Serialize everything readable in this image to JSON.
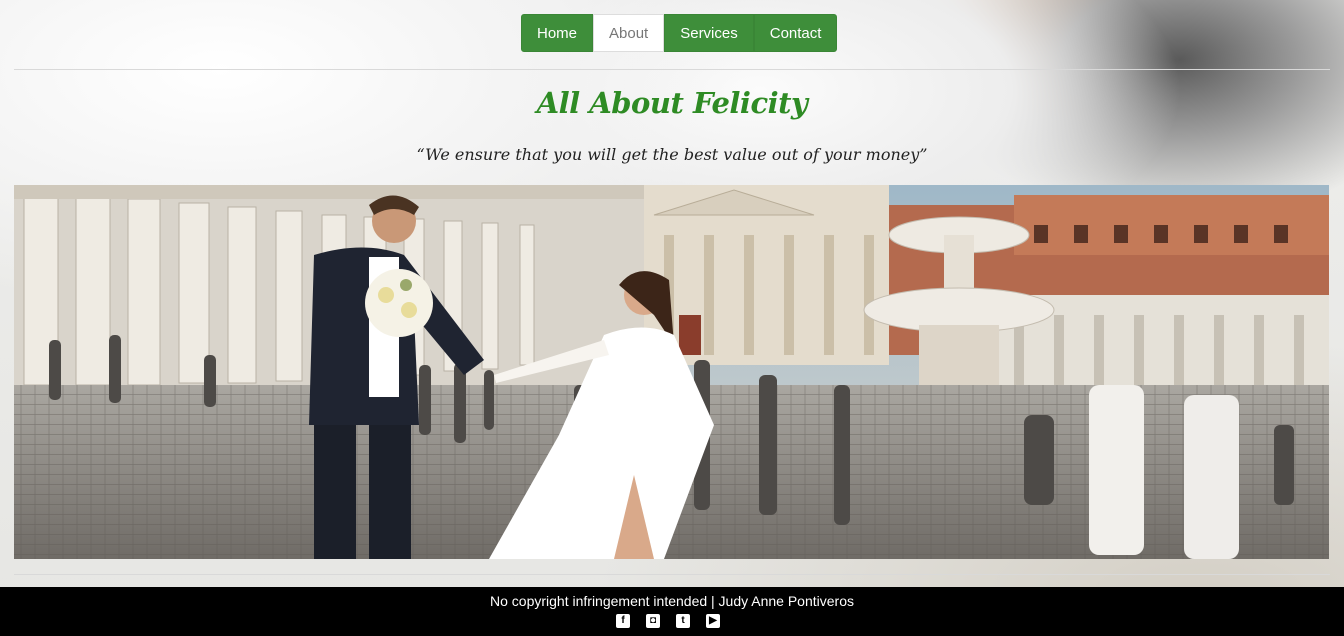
{
  "nav": {
    "items": [
      {
        "label": "Home",
        "active": false
      },
      {
        "label": "About",
        "active": true
      },
      {
        "label": "Services",
        "active": false
      },
      {
        "label": "Contact",
        "active": false
      }
    ]
  },
  "page": {
    "title": "All About Felicity",
    "tagline": "“We ensure that you will get the best value out of your money”"
  },
  "footer": {
    "text": "No copyright infringement intended | Judy Anne Pontiveros",
    "social": [
      {
        "icon": "facebook-icon",
        "glyph": "f"
      },
      {
        "icon": "instagram-icon",
        "glyph": "◘"
      },
      {
        "icon": "twitter-icon",
        "glyph": "t"
      },
      {
        "icon": "youtube-icon",
        "glyph": "▶"
      }
    ]
  },
  "colors": {
    "nav_green": "#3e8e3a",
    "title_green": "#2e8b24",
    "footer_bg": "#000000"
  }
}
